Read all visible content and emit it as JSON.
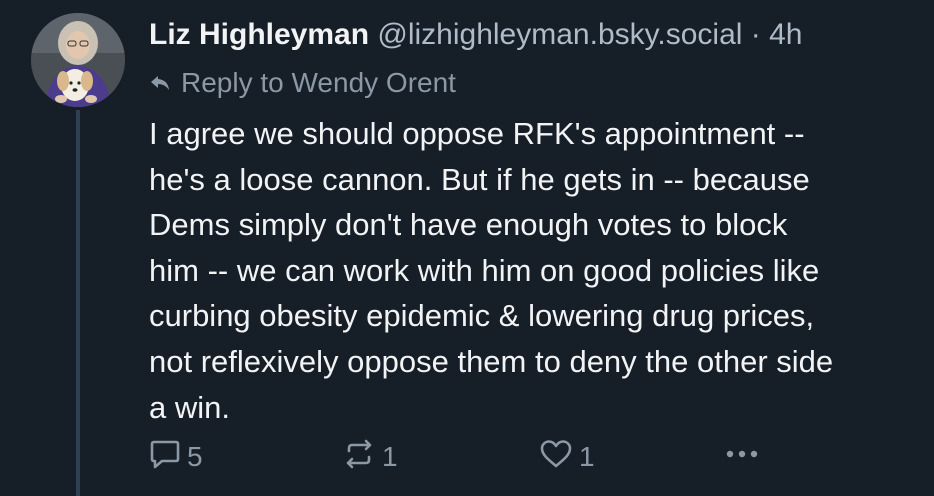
{
  "post": {
    "author": {
      "display_name": "Liz Highleyman",
      "handle": "@lizhighleyman.bsky.social"
    },
    "separator": "·",
    "timestamp": "4h",
    "reply_to": "Reply to Wendy Orent",
    "text": "I agree we should oppose RFK's appointment --\nhe's a loose cannon. But if he gets in -- because\nDems simply don't have enough votes to block\nhim -- we can work with him on good policies like\ncurbing obesity epidemic & lowering drug prices,\nnot reflexively oppose them to deny the other side\na win.",
    "actions": {
      "reply_count": "5",
      "repost_count": "1",
      "like_count": "1"
    }
  },
  "icons": {
    "reply": "speech-bubble-icon",
    "repost": "repost-arrows-icon",
    "like": "heart-icon",
    "more": "ellipsis-icon",
    "reply_indicator": "reply-arrow-icon"
  },
  "colors": {
    "background": "#161e27",
    "text_primary": "#f1f3f5",
    "text_secondary": "#aebbc9",
    "text_muted": "#8b98a5",
    "thread_line": "#2e4052"
  }
}
